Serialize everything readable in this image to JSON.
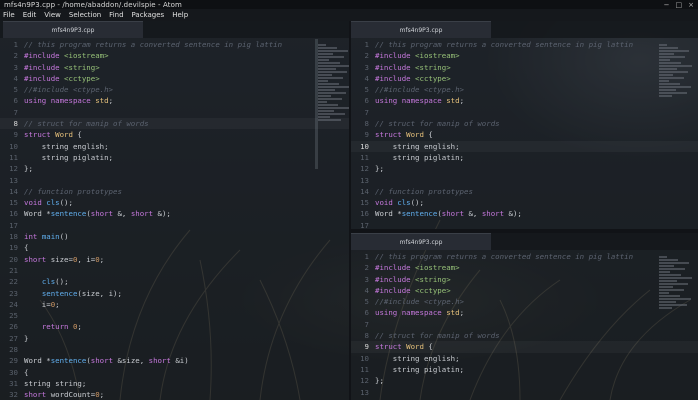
{
  "window": {
    "title": "mfs4n9P3.cpp - /home/abaddon/.devilspie - Atom",
    "controls": [
      "−",
      "□",
      "×"
    ]
  },
  "menu": [
    "File",
    "Edit",
    "View",
    "Selection",
    "Find",
    "Packages",
    "Help"
  ],
  "panes": {
    "left": {
      "tab": "mfs4n9P3.cpp",
      "active_line": 8,
      "lines": [
        {
          "n": "1",
          "tokens": [
            {
              "t": "// this program returns a converted sentence in pig lattin",
              "c": "com"
            }
          ]
        },
        {
          "n": "2",
          "tokens": [
            {
              "t": "#include ",
              "c": "pre"
            },
            {
              "t": "<iostream>",
              "c": "inc"
            }
          ]
        },
        {
          "n": "3",
          "tokens": [
            {
              "t": "#include ",
              "c": "pre"
            },
            {
              "t": "<string>",
              "c": "inc"
            }
          ]
        },
        {
          "n": "4",
          "tokens": [
            {
              "t": "#include ",
              "c": "pre"
            },
            {
              "t": "<cctype>",
              "c": "inc"
            }
          ]
        },
        {
          "n": "5",
          "tokens": [
            {
              "t": "//#include <ctype.h>",
              "c": "com"
            }
          ]
        },
        {
          "n": "6",
          "tokens": [
            {
              "t": "using ",
              "c": "kw"
            },
            {
              "t": "namespace ",
              "c": "kw"
            },
            {
              "t": "std",
              "c": "ns"
            },
            {
              "t": ";",
              "c": "plain"
            }
          ]
        },
        {
          "n": "7",
          "tokens": []
        },
        {
          "n": "8",
          "tokens": [
            {
              "t": "// struct for manip of words",
              "c": "com"
            }
          ]
        },
        {
          "n": "9",
          "tokens": [
            {
              "t": "struct ",
              "c": "kw"
            },
            {
              "t": "Word",
              "c": "type"
            },
            {
              "t": " {",
              "c": "plain"
            }
          ]
        },
        {
          "n": "10",
          "tokens": [
            {
              "t": "    string english;",
              "c": "plain"
            }
          ]
        },
        {
          "n": "11",
          "tokens": [
            {
              "t": "    string piglatin;",
              "c": "plain"
            }
          ]
        },
        {
          "n": "12",
          "tokens": [
            {
              "t": "};",
              "c": "plain"
            }
          ]
        },
        {
          "n": "13",
          "tokens": []
        },
        {
          "n": "14",
          "tokens": [
            {
              "t": "// function prototypes",
              "c": "com"
            }
          ]
        },
        {
          "n": "15",
          "tokens": [
            {
              "t": "void ",
              "c": "kw"
            },
            {
              "t": "cls",
              "c": "fn"
            },
            {
              "t": "();",
              "c": "plain"
            }
          ]
        },
        {
          "n": "16",
          "tokens": [
            {
              "t": "Word *",
              "c": "plain"
            },
            {
              "t": "sentence",
              "c": "fn"
            },
            {
              "t": "(",
              "c": "plain"
            },
            {
              "t": "short",
              "c": "kw"
            },
            {
              "t": " &, ",
              "c": "plain"
            },
            {
              "t": "short",
              "c": "kw"
            },
            {
              "t": " &);",
              "c": "plain"
            }
          ]
        },
        {
          "n": "17",
          "tokens": []
        },
        {
          "n": "18",
          "tokens": [
            {
              "t": "int ",
              "c": "kw"
            },
            {
              "t": "main",
              "c": "fn"
            },
            {
              "t": "()",
              "c": "plain"
            }
          ]
        },
        {
          "n": "19",
          "tokens": [
            {
              "t": "{",
              "c": "plain"
            }
          ]
        },
        {
          "n": "20",
          "tokens": [
            {
              "t": "short",
              "c": "kw"
            },
            {
              "t": " size=",
              "c": "plain"
            },
            {
              "t": "0",
              "c": "num"
            },
            {
              "t": ", i=",
              "c": "plain"
            },
            {
              "t": "0",
              "c": "num"
            },
            {
              "t": ";",
              "c": "plain"
            }
          ]
        },
        {
          "n": "21",
          "tokens": []
        },
        {
          "n": "22",
          "tokens": [
            {
              "t": "    ",
              "c": "plain"
            },
            {
              "t": "cls",
              "c": "fn"
            },
            {
              "t": "();",
              "c": "plain"
            }
          ]
        },
        {
          "n": "23",
          "tokens": [
            {
              "t": "    ",
              "c": "plain"
            },
            {
              "t": "sentence",
              "c": "fn"
            },
            {
              "t": "(size, i);",
              "c": "plain"
            }
          ]
        },
        {
          "n": "24",
          "tokens": [
            {
              "t": "    i=",
              "c": "plain"
            },
            {
              "t": "0",
              "c": "num"
            },
            {
              "t": ";",
              "c": "plain"
            }
          ]
        },
        {
          "n": "25",
          "tokens": []
        },
        {
          "n": "26",
          "tokens": [
            {
              "t": "    ",
              "c": "plain"
            },
            {
              "t": "return ",
              "c": "kw"
            },
            {
              "t": "0",
              "c": "num"
            },
            {
              "t": ";",
              "c": "plain"
            }
          ]
        },
        {
          "n": "27",
          "tokens": [
            {
              "t": "}",
              "c": "plain"
            }
          ]
        },
        {
          "n": "28",
          "tokens": []
        },
        {
          "n": "29",
          "tokens": [
            {
              "t": "Word *",
              "c": "plain"
            },
            {
              "t": "sentence",
              "c": "fn"
            },
            {
              "t": "(",
              "c": "plain"
            },
            {
              "t": "short",
              "c": "kw"
            },
            {
              "t": " &size, ",
              "c": "plain"
            },
            {
              "t": "short",
              "c": "kw"
            },
            {
              "t": " &i)",
              "c": "plain"
            }
          ]
        },
        {
          "n": "30",
          "tokens": [
            {
              "t": "{",
              "c": "plain"
            }
          ]
        },
        {
          "n": "31",
          "tokens": [
            {
              "t": "string string;",
              "c": "plain"
            }
          ]
        },
        {
          "n": "32",
          "tokens": [
            {
              "t": "short",
              "c": "kw"
            },
            {
              "t": " wordCount=",
              "c": "plain"
            },
            {
              "t": "0",
              "c": "num"
            },
            {
              "t": ";",
              "c": "plain"
            }
          ]
        }
      ]
    },
    "right_top": {
      "tab": "mfs4n9P3.cpp",
      "active_line": 10,
      "lines": [
        {
          "n": "1",
          "tokens": [
            {
              "t": "// this program returns a converted sentence in pig lattin",
              "c": "com"
            }
          ]
        },
        {
          "n": "2",
          "tokens": [
            {
              "t": "#include ",
              "c": "pre"
            },
            {
              "t": "<iostream>",
              "c": "inc"
            }
          ]
        },
        {
          "n": "3",
          "tokens": [
            {
              "t": "#include ",
              "c": "pre"
            },
            {
              "t": "<string>",
              "c": "inc"
            }
          ]
        },
        {
          "n": "4",
          "tokens": [
            {
              "t": "#include ",
              "c": "pre"
            },
            {
              "t": "<cctype>",
              "c": "inc"
            }
          ]
        },
        {
          "n": "5",
          "tokens": [
            {
              "t": "//#include <ctype.h>",
              "c": "com"
            }
          ]
        },
        {
          "n": "6",
          "tokens": [
            {
              "t": "using ",
              "c": "kw"
            },
            {
              "t": "namespace ",
              "c": "kw"
            },
            {
              "t": "std",
              "c": "ns"
            },
            {
              "t": ";",
              "c": "plain"
            }
          ]
        },
        {
          "n": "7",
          "tokens": []
        },
        {
          "n": "8",
          "tokens": [
            {
              "t": "// struct for manip of words",
              "c": "com"
            }
          ]
        },
        {
          "n": "9",
          "tokens": [
            {
              "t": "struct ",
              "c": "kw"
            },
            {
              "t": "Word",
              "c": "type"
            },
            {
              "t": " {",
              "c": "plain"
            }
          ]
        },
        {
          "n": "10",
          "tokens": [
            {
              "t": "    string english;",
              "c": "plain"
            }
          ]
        },
        {
          "n": "11",
          "tokens": [
            {
              "t": "    string piglatin;",
              "c": "plain"
            }
          ]
        },
        {
          "n": "12",
          "tokens": [
            {
              "t": "};",
              "c": "plain"
            }
          ]
        },
        {
          "n": "13",
          "tokens": []
        },
        {
          "n": "14",
          "tokens": [
            {
              "t": "// function prototypes",
              "c": "com"
            }
          ]
        },
        {
          "n": "15",
          "tokens": [
            {
              "t": "void ",
              "c": "kw"
            },
            {
              "t": "cls",
              "c": "fn"
            },
            {
              "t": "();",
              "c": "plain"
            }
          ]
        },
        {
          "n": "16",
          "tokens": [
            {
              "t": "Word *",
              "c": "plain"
            },
            {
              "t": "sentence",
              "c": "fn"
            },
            {
              "t": "(",
              "c": "plain"
            },
            {
              "t": "short",
              "c": "kw"
            },
            {
              "t": " &, ",
              "c": "plain"
            },
            {
              "t": "short",
              "c": "kw"
            },
            {
              "t": " &);",
              "c": "plain"
            }
          ]
        },
        {
          "n": "17",
          "tokens": []
        }
      ]
    },
    "right_bottom": {
      "tab": "mfs4n9P3.cpp",
      "active_line": 9,
      "lines": [
        {
          "n": "1",
          "tokens": [
            {
              "t": "// this program returns a converted sentence in pig lattin",
              "c": "com"
            }
          ]
        },
        {
          "n": "2",
          "tokens": [
            {
              "t": "#include ",
              "c": "pre"
            },
            {
              "t": "<iostream>",
              "c": "inc"
            }
          ]
        },
        {
          "n": "3",
          "tokens": [
            {
              "t": "#include ",
              "c": "pre"
            },
            {
              "t": "<string>",
              "c": "inc"
            }
          ]
        },
        {
          "n": "4",
          "tokens": [
            {
              "t": "#include ",
              "c": "pre"
            },
            {
              "t": "<cctype>",
              "c": "inc"
            }
          ]
        },
        {
          "n": "5",
          "tokens": [
            {
              "t": "//#include <ctype.h>",
              "c": "com"
            }
          ]
        },
        {
          "n": "6",
          "tokens": [
            {
              "t": "using ",
              "c": "kw"
            },
            {
              "t": "namespace ",
              "c": "kw"
            },
            {
              "t": "std",
              "c": "ns"
            },
            {
              "t": ";",
              "c": "plain"
            }
          ]
        },
        {
          "n": "7",
          "tokens": []
        },
        {
          "n": "8",
          "tokens": [
            {
              "t": "// struct for manip of words",
              "c": "com"
            }
          ]
        },
        {
          "n": "9",
          "tokens": [
            {
              "t": "struct ",
              "c": "kw"
            },
            {
              "t": "Word",
              "c": "type"
            },
            {
              "t": " {",
              "c": "plain"
            }
          ]
        },
        {
          "n": "10",
          "tokens": [
            {
              "t": "    string english;",
              "c": "plain"
            }
          ]
        },
        {
          "n": "11",
          "tokens": [
            {
              "t": "    string piglatin;",
              "c": "plain"
            }
          ]
        },
        {
          "n": "12",
          "tokens": [
            {
              "t": "};",
              "c": "plain"
            }
          ]
        },
        {
          "n": "13",
          "tokens": []
        }
      ]
    }
  },
  "colors": {
    "comment": "#5c6370",
    "keyword": "#c678dd",
    "include": "#98c379",
    "type": "#e5c07b",
    "function": "#61afef",
    "number": "#d19a66"
  }
}
